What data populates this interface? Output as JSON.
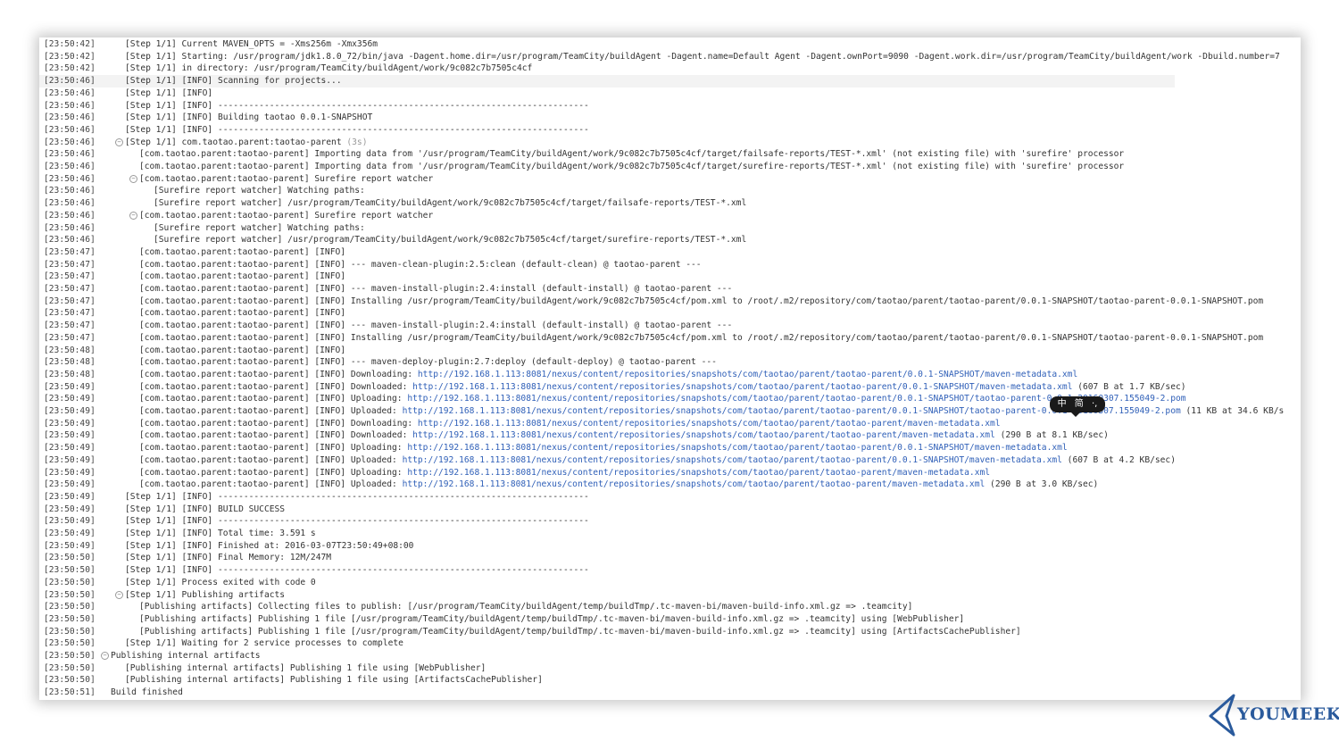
{
  "log": {
    "lines": [
      {
        "ts": "[23:50:42]",
        "indent": 1,
        "toggle": false,
        "text": "[Step 1/1] Current MAVEN_OPTS = -Xms256m -Xmx356m"
      },
      {
        "ts": "[23:50:42]",
        "indent": 1,
        "toggle": false,
        "text": "[Step 1/1] Starting: /usr/program/jdk1.8.0_72/bin/java -Dagent.home.dir=/usr/program/TeamCity/buildAgent -Dagent.name=Default Agent -Dagent.ownPort=9090 -Dagent.work.dir=/usr/program/TeamCity/buildAgent/work -Dbuild.number=7"
      },
      {
        "ts": "[23:50:42]",
        "indent": 1,
        "toggle": false,
        "text": "[Step 1/1] in directory: /usr/program/TeamCity/buildAgent/work/9c082c7b7505c4cf"
      },
      {
        "ts": "[23:50:46]",
        "indent": 1,
        "toggle": false,
        "text": "[Step 1/1] [INFO] Scanning for projects...",
        "highlight": true
      },
      {
        "ts": "[23:50:46]",
        "indent": 1,
        "toggle": false,
        "text": "[Step 1/1] [INFO]"
      },
      {
        "ts": "[23:50:46]",
        "indent": 1,
        "toggle": false,
        "text": "[Step 1/1] [INFO] ------------------------------------------------------------------------"
      },
      {
        "ts": "[23:50:46]",
        "indent": 1,
        "toggle": false,
        "text": "[Step 1/1] [INFO] Building taotao 0.0.1-SNAPSHOT"
      },
      {
        "ts": "[23:50:46]",
        "indent": 1,
        "toggle": false,
        "text": "[Step 1/1] [INFO] ------------------------------------------------------------------------"
      },
      {
        "ts": "[23:50:46]",
        "indent": 1,
        "toggle": true,
        "text": "[Step 1/1] com.taotao.parent:taotao-parent",
        "suffix": " (3s)"
      },
      {
        "ts": "[23:50:46]",
        "indent": 2,
        "toggle": false,
        "text": "[com.taotao.parent:taotao-parent] Importing data from '/usr/program/TeamCity/buildAgent/work/9c082c7b7505c4cf/target/failsafe-reports/TEST-*.xml' (not existing file) with 'surefire' processor"
      },
      {
        "ts": "[23:50:46]",
        "indent": 2,
        "toggle": false,
        "text": "[com.taotao.parent:taotao-parent] Importing data from '/usr/program/TeamCity/buildAgent/work/9c082c7b7505c4cf/target/surefire-reports/TEST-*.xml' (not existing file) with 'surefire' processor"
      },
      {
        "ts": "[23:50:46]",
        "indent": 2,
        "toggle": true,
        "text": "[com.taotao.parent:taotao-parent] Surefire report watcher"
      },
      {
        "ts": "[23:50:46]",
        "indent": 3,
        "toggle": false,
        "text": "[Surefire report watcher] Watching paths:"
      },
      {
        "ts": "[23:50:46]",
        "indent": 3,
        "toggle": false,
        "text": "[Surefire report watcher] /usr/program/TeamCity/buildAgent/work/9c082c7b7505c4cf/target/failsafe-reports/TEST-*.xml"
      },
      {
        "ts": "[23:50:46]",
        "indent": 2,
        "toggle": true,
        "text": "[com.taotao.parent:taotao-parent] Surefire report watcher"
      },
      {
        "ts": "[23:50:46]",
        "indent": 3,
        "toggle": false,
        "text": "[Surefire report watcher] Watching paths:"
      },
      {
        "ts": "[23:50:46]",
        "indent": 3,
        "toggle": false,
        "text": "[Surefire report watcher] /usr/program/TeamCity/buildAgent/work/9c082c7b7505c4cf/target/surefire-reports/TEST-*.xml"
      },
      {
        "ts": "[23:50:47]",
        "indent": 2,
        "toggle": false,
        "text": "[com.taotao.parent:taotao-parent] [INFO]"
      },
      {
        "ts": "[23:50:47]",
        "indent": 2,
        "toggle": false,
        "text": "[com.taotao.parent:taotao-parent] [INFO] --- maven-clean-plugin:2.5:clean (default-clean) @ taotao-parent ---"
      },
      {
        "ts": "[23:50:47]",
        "indent": 2,
        "toggle": false,
        "text": "[com.taotao.parent:taotao-parent] [INFO]"
      },
      {
        "ts": "[23:50:47]",
        "indent": 2,
        "toggle": false,
        "text": "[com.taotao.parent:taotao-parent] [INFO] --- maven-install-plugin:2.4:install (default-install) @ taotao-parent ---"
      },
      {
        "ts": "[23:50:47]",
        "indent": 2,
        "toggle": false,
        "text": "[com.taotao.parent:taotao-parent] [INFO] Installing /usr/program/TeamCity/buildAgent/work/9c082c7b7505c4cf/pom.xml to /root/.m2/repository/com/taotao/parent/taotao-parent/0.0.1-SNAPSHOT/taotao-parent-0.0.1-SNAPSHOT.pom"
      },
      {
        "ts": "[23:50:47]",
        "indent": 2,
        "toggle": false,
        "text": "[com.taotao.parent:taotao-parent] [INFO]"
      },
      {
        "ts": "[23:50:47]",
        "indent": 2,
        "toggle": false,
        "text": "[com.taotao.parent:taotao-parent] [INFO] --- maven-install-plugin:2.4:install (default-install) @ taotao-parent ---"
      },
      {
        "ts": "[23:50:47]",
        "indent": 2,
        "toggle": false,
        "text": "[com.taotao.parent:taotao-parent] [INFO] Installing /usr/program/TeamCity/buildAgent/work/9c082c7b7505c4cf/pom.xml to /root/.m2/repository/com/taotao/parent/taotao-parent/0.0.1-SNAPSHOT/taotao-parent-0.0.1-SNAPSHOT.pom"
      },
      {
        "ts": "[23:50:48]",
        "indent": 2,
        "toggle": false,
        "text": "[com.taotao.parent:taotao-parent] [INFO]"
      },
      {
        "ts": "[23:50:48]",
        "indent": 2,
        "toggle": false,
        "text": "[com.taotao.parent:taotao-parent] [INFO] --- maven-deploy-plugin:2.7:deploy (default-deploy) @ taotao-parent ---"
      },
      {
        "ts": "[23:50:48]",
        "indent": 2,
        "toggle": false,
        "text": "[com.taotao.parent:taotao-parent] [INFO] Downloading: ",
        "link": "http://192.168.1.113:8081/nexus/content/repositories/snapshots/com/taotao/parent/taotao-parent/0.0.1-SNAPSHOT/maven-metadata.xml"
      },
      {
        "ts": "[23:50:49]",
        "indent": 2,
        "toggle": false,
        "text": "[com.taotao.parent:taotao-parent] [INFO] Downloaded: ",
        "link": "http://192.168.1.113:8081/nexus/content/repositories/snapshots/com/taotao/parent/taotao-parent/0.0.1-SNAPSHOT/maven-metadata.xml",
        "after": " (607 B at 1.7 KB/sec)"
      },
      {
        "ts": "[23:50:49]",
        "indent": 2,
        "toggle": false,
        "text": "[com.taotao.parent:taotao-parent] [INFO] Uploading: ",
        "link": "http://192.168.1.113:8081/nexus/content/repositories/snapshots/com/taotao/parent/taotao-parent/0.0.1-SNAPSHOT/taotao-parent-0.0.1-20160307.155049-2.pom"
      },
      {
        "ts": "[23:50:49]",
        "indent": 2,
        "toggle": false,
        "text": "[com.taotao.parent:taotao-parent] [INFO] Uploaded: ",
        "link": "http://192.168.1.113:8081/nexus/content/repositories/snapshots/com/taotao/parent/taotao-parent/0.0.1-SNAPSHOT/taotao-parent-0.0.1-20160307.155049-2.pom",
        "after": " (11 KB at 34.6 KB/s"
      },
      {
        "ts": "[23:50:49]",
        "indent": 2,
        "toggle": false,
        "text": "[com.taotao.parent:taotao-parent] [INFO] Downloading: ",
        "link": "http://192.168.1.113:8081/nexus/content/repositories/snapshots/com/taotao/parent/taotao-parent/maven-metadata.xml"
      },
      {
        "ts": "[23:50:49]",
        "indent": 2,
        "toggle": false,
        "text": "[com.taotao.parent:taotao-parent] [INFO] Downloaded: ",
        "link": "http://192.168.1.113:8081/nexus/content/repositories/snapshots/com/taotao/parent/taotao-parent/maven-metadata.xml",
        "after": " (290 B at 8.1 KB/sec)"
      },
      {
        "ts": "[23:50:49]",
        "indent": 2,
        "toggle": false,
        "text": "[com.taotao.parent:taotao-parent] [INFO] Uploading: ",
        "link": "http://192.168.1.113:8081/nexus/content/repositories/snapshots/com/taotao/parent/taotao-parent/0.0.1-SNAPSHOT/maven-metadata.xml"
      },
      {
        "ts": "[23:50:49]",
        "indent": 2,
        "toggle": false,
        "text": "[com.taotao.parent:taotao-parent] [INFO] Uploaded: ",
        "link": "http://192.168.1.113:8081/nexus/content/repositories/snapshots/com/taotao/parent/taotao-parent/0.0.1-SNAPSHOT/maven-metadata.xml",
        "after": " (607 B at 4.2 KB/sec)"
      },
      {
        "ts": "[23:50:49]",
        "indent": 2,
        "toggle": false,
        "text": "[com.taotao.parent:taotao-parent] [INFO] Uploading: ",
        "link": "http://192.168.1.113:8081/nexus/content/repositories/snapshots/com/taotao/parent/taotao-parent/maven-metadata.xml"
      },
      {
        "ts": "[23:50:49]",
        "indent": 2,
        "toggle": false,
        "text": "[com.taotao.parent:taotao-parent] [INFO] Uploaded: ",
        "link": "http://192.168.1.113:8081/nexus/content/repositories/snapshots/com/taotao/parent/taotao-parent/maven-metadata.xml",
        "after": " (290 B at 3.0 KB/sec)"
      },
      {
        "ts": "[23:50:49]",
        "indent": 1,
        "toggle": false,
        "text": "[Step 1/1] [INFO] ------------------------------------------------------------------------"
      },
      {
        "ts": "[23:50:49]",
        "indent": 1,
        "toggle": false,
        "text": "[Step 1/1] [INFO] BUILD SUCCESS"
      },
      {
        "ts": "[23:50:49]",
        "indent": 1,
        "toggle": false,
        "text": "[Step 1/1] [INFO] ------------------------------------------------------------------------"
      },
      {
        "ts": "[23:50:49]",
        "indent": 1,
        "toggle": false,
        "text": "[Step 1/1] [INFO] Total time: 3.591 s"
      },
      {
        "ts": "[23:50:49]",
        "indent": 1,
        "toggle": false,
        "text": "[Step 1/1] [INFO] Finished at: 2016-03-07T23:50:49+08:00"
      },
      {
        "ts": "[23:50:50]",
        "indent": 1,
        "toggle": false,
        "text": "[Step 1/1] [INFO] Final Memory: 12M/247M"
      },
      {
        "ts": "[23:50:50]",
        "indent": 1,
        "toggle": false,
        "text": "[Step 1/1] [INFO] ------------------------------------------------------------------------"
      },
      {
        "ts": "[23:50:50]",
        "indent": 1,
        "toggle": false,
        "text": "[Step 1/1] Process exited with code 0"
      },
      {
        "ts": "[23:50:50]",
        "indent": 1,
        "toggle": true,
        "text": "[Step 1/1] Publishing artifacts"
      },
      {
        "ts": "[23:50:50]",
        "indent": 2,
        "toggle": false,
        "text": "[Publishing artifacts] Collecting files to publish: [/usr/program/TeamCity/buildAgent/temp/buildTmp/.tc-maven-bi/maven-build-info.xml.gz => .teamcity]"
      },
      {
        "ts": "[23:50:50]",
        "indent": 2,
        "toggle": false,
        "text": "[Publishing artifacts] Publishing 1 file [/usr/program/TeamCity/buildAgent/temp/buildTmp/.tc-maven-bi/maven-build-info.xml.gz => .teamcity] using [WebPublisher]"
      },
      {
        "ts": "[23:50:50]",
        "indent": 2,
        "toggle": false,
        "text": "[Publishing artifacts] Publishing 1 file [/usr/program/TeamCity/buildAgent/temp/buildTmp/.tc-maven-bi/maven-build-info.xml.gz => .teamcity] using [ArtifactsCachePublisher]"
      },
      {
        "ts": "[23:50:50]",
        "indent": 1,
        "toggle": false,
        "text": "[Step 1/1] Waiting for 2 service processes to complete"
      },
      {
        "ts": "[23:50:50]",
        "indent": 0,
        "toggle": true,
        "text": "Publishing internal artifacts"
      },
      {
        "ts": "[23:50:50]",
        "indent": 1,
        "toggle": false,
        "text": "[Publishing internal artifacts] Publishing 1 file using [WebPublisher]"
      },
      {
        "ts": "[23:50:50]",
        "indent": 1,
        "toggle": false,
        "text": "[Publishing internal artifacts] Publishing 1 file using [ArtifactsCachePublisher]"
      },
      {
        "ts": "[23:50:51]",
        "indent": 0,
        "toggle": false,
        "text": "Build finished"
      }
    ]
  },
  "ime_tooltip": {
    "left": "中",
    "right": "简",
    "extra": "·,"
  },
  "brand": {
    "name": "YOUMEEK",
    "color": "#2a5a9c"
  }
}
